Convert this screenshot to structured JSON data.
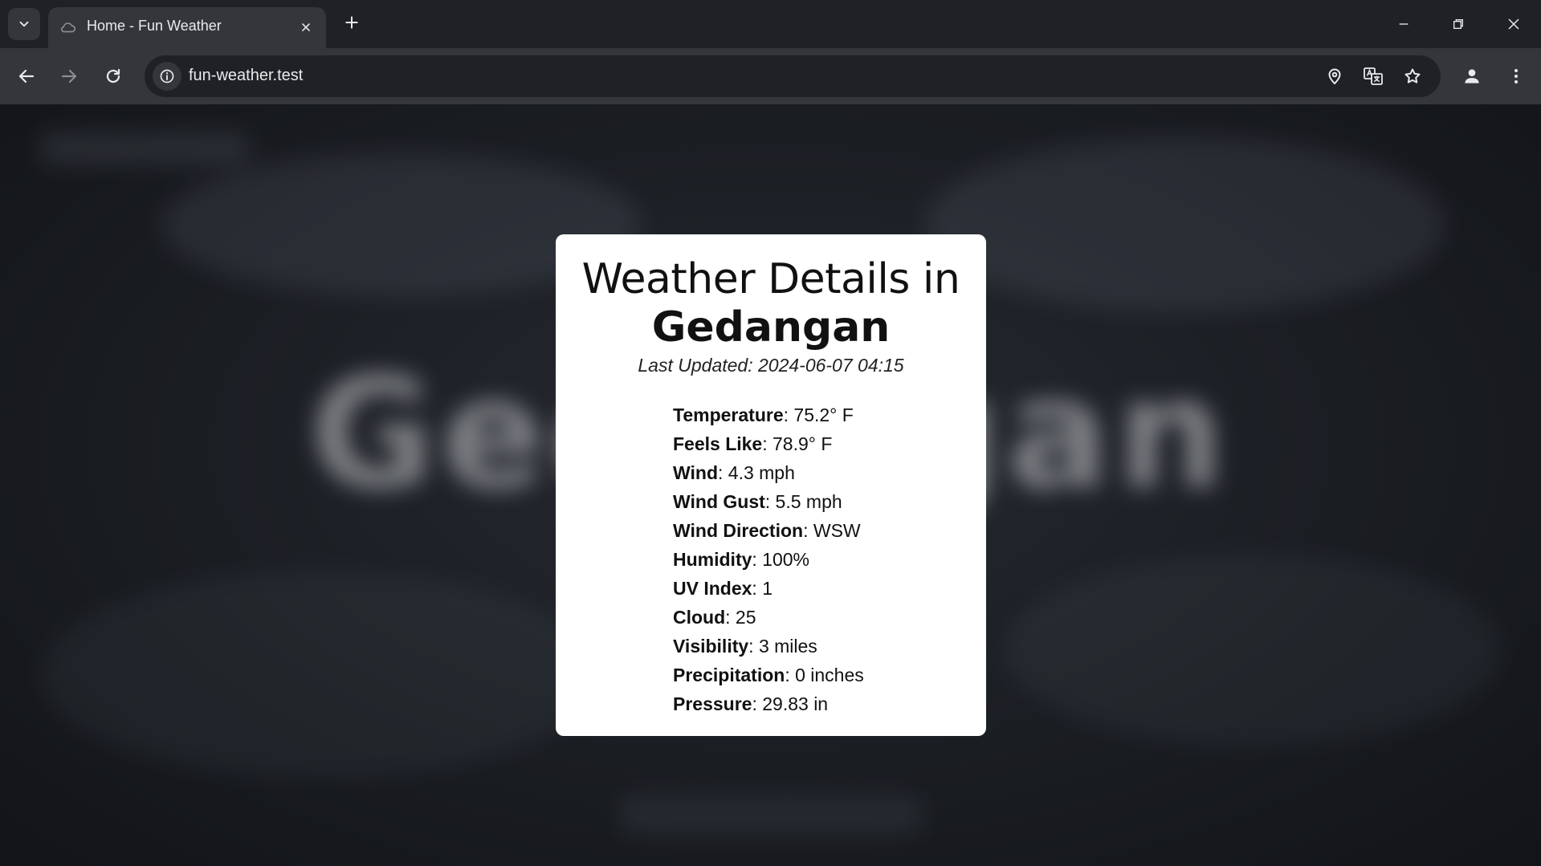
{
  "browser": {
    "tab_title": "Home - Fun Weather",
    "url": "fun-weather.test"
  },
  "colors": {
    "chrome_dark": "#202124",
    "chrome_toolbar": "#35363a",
    "icon": "#e8eaed",
    "card_bg": "#ffffff"
  },
  "icons": {
    "tab_search": "chevron-down-icon",
    "favicon": "cloud-icon",
    "tab_close": "close-icon",
    "new_tab": "plus-icon",
    "minimize": "minimize-icon",
    "restore": "restore-icon",
    "close_window": "close-icon",
    "back": "arrow-left-icon",
    "forward": "arrow-right-icon",
    "reload": "reload-icon",
    "site_info": "info-icon",
    "location": "location-pin-icon",
    "translate": "translate-icon",
    "bookmark": "star-icon",
    "profile": "person-icon",
    "menu": "kebab-menu-icon"
  },
  "background": {
    "city_text": "Gedangan"
  },
  "card": {
    "title": "Weather Details in",
    "city": "Gedangan",
    "last_updated": "Last Updated: 2024-06-07 04:15",
    "details": [
      {
        "label": "Temperature",
        "value": ": 75.2° F"
      },
      {
        "label": "Feels Like",
        "value": ": 78.9° F"
      },
      {
        "label": "Wind",
        "value": ": 4.3 mph"
      },
      {
        "label": "Wind Gust",
        "value": ": 5.5 mph"
      },
      {
        "label": "Wind Direction",
        "value": ": WSW"
      },
      {
        "label": "Humidity",
        "value": ": 100%"
      },
      {
        "label": "UV Index",
        "value": ": 1"
      },
      {
        "label": "Cloud",
        "value": ": 25"
      },
      {
        "label": "Visibility",
        "value": ": 3 miles"
      },
      {
        "label": "Precipitation",
        "value": ": 0 inches"
      },
      {
        "label": "Pressure",
        "value": ": 29.83 in"
      }
    ]
  }
}
